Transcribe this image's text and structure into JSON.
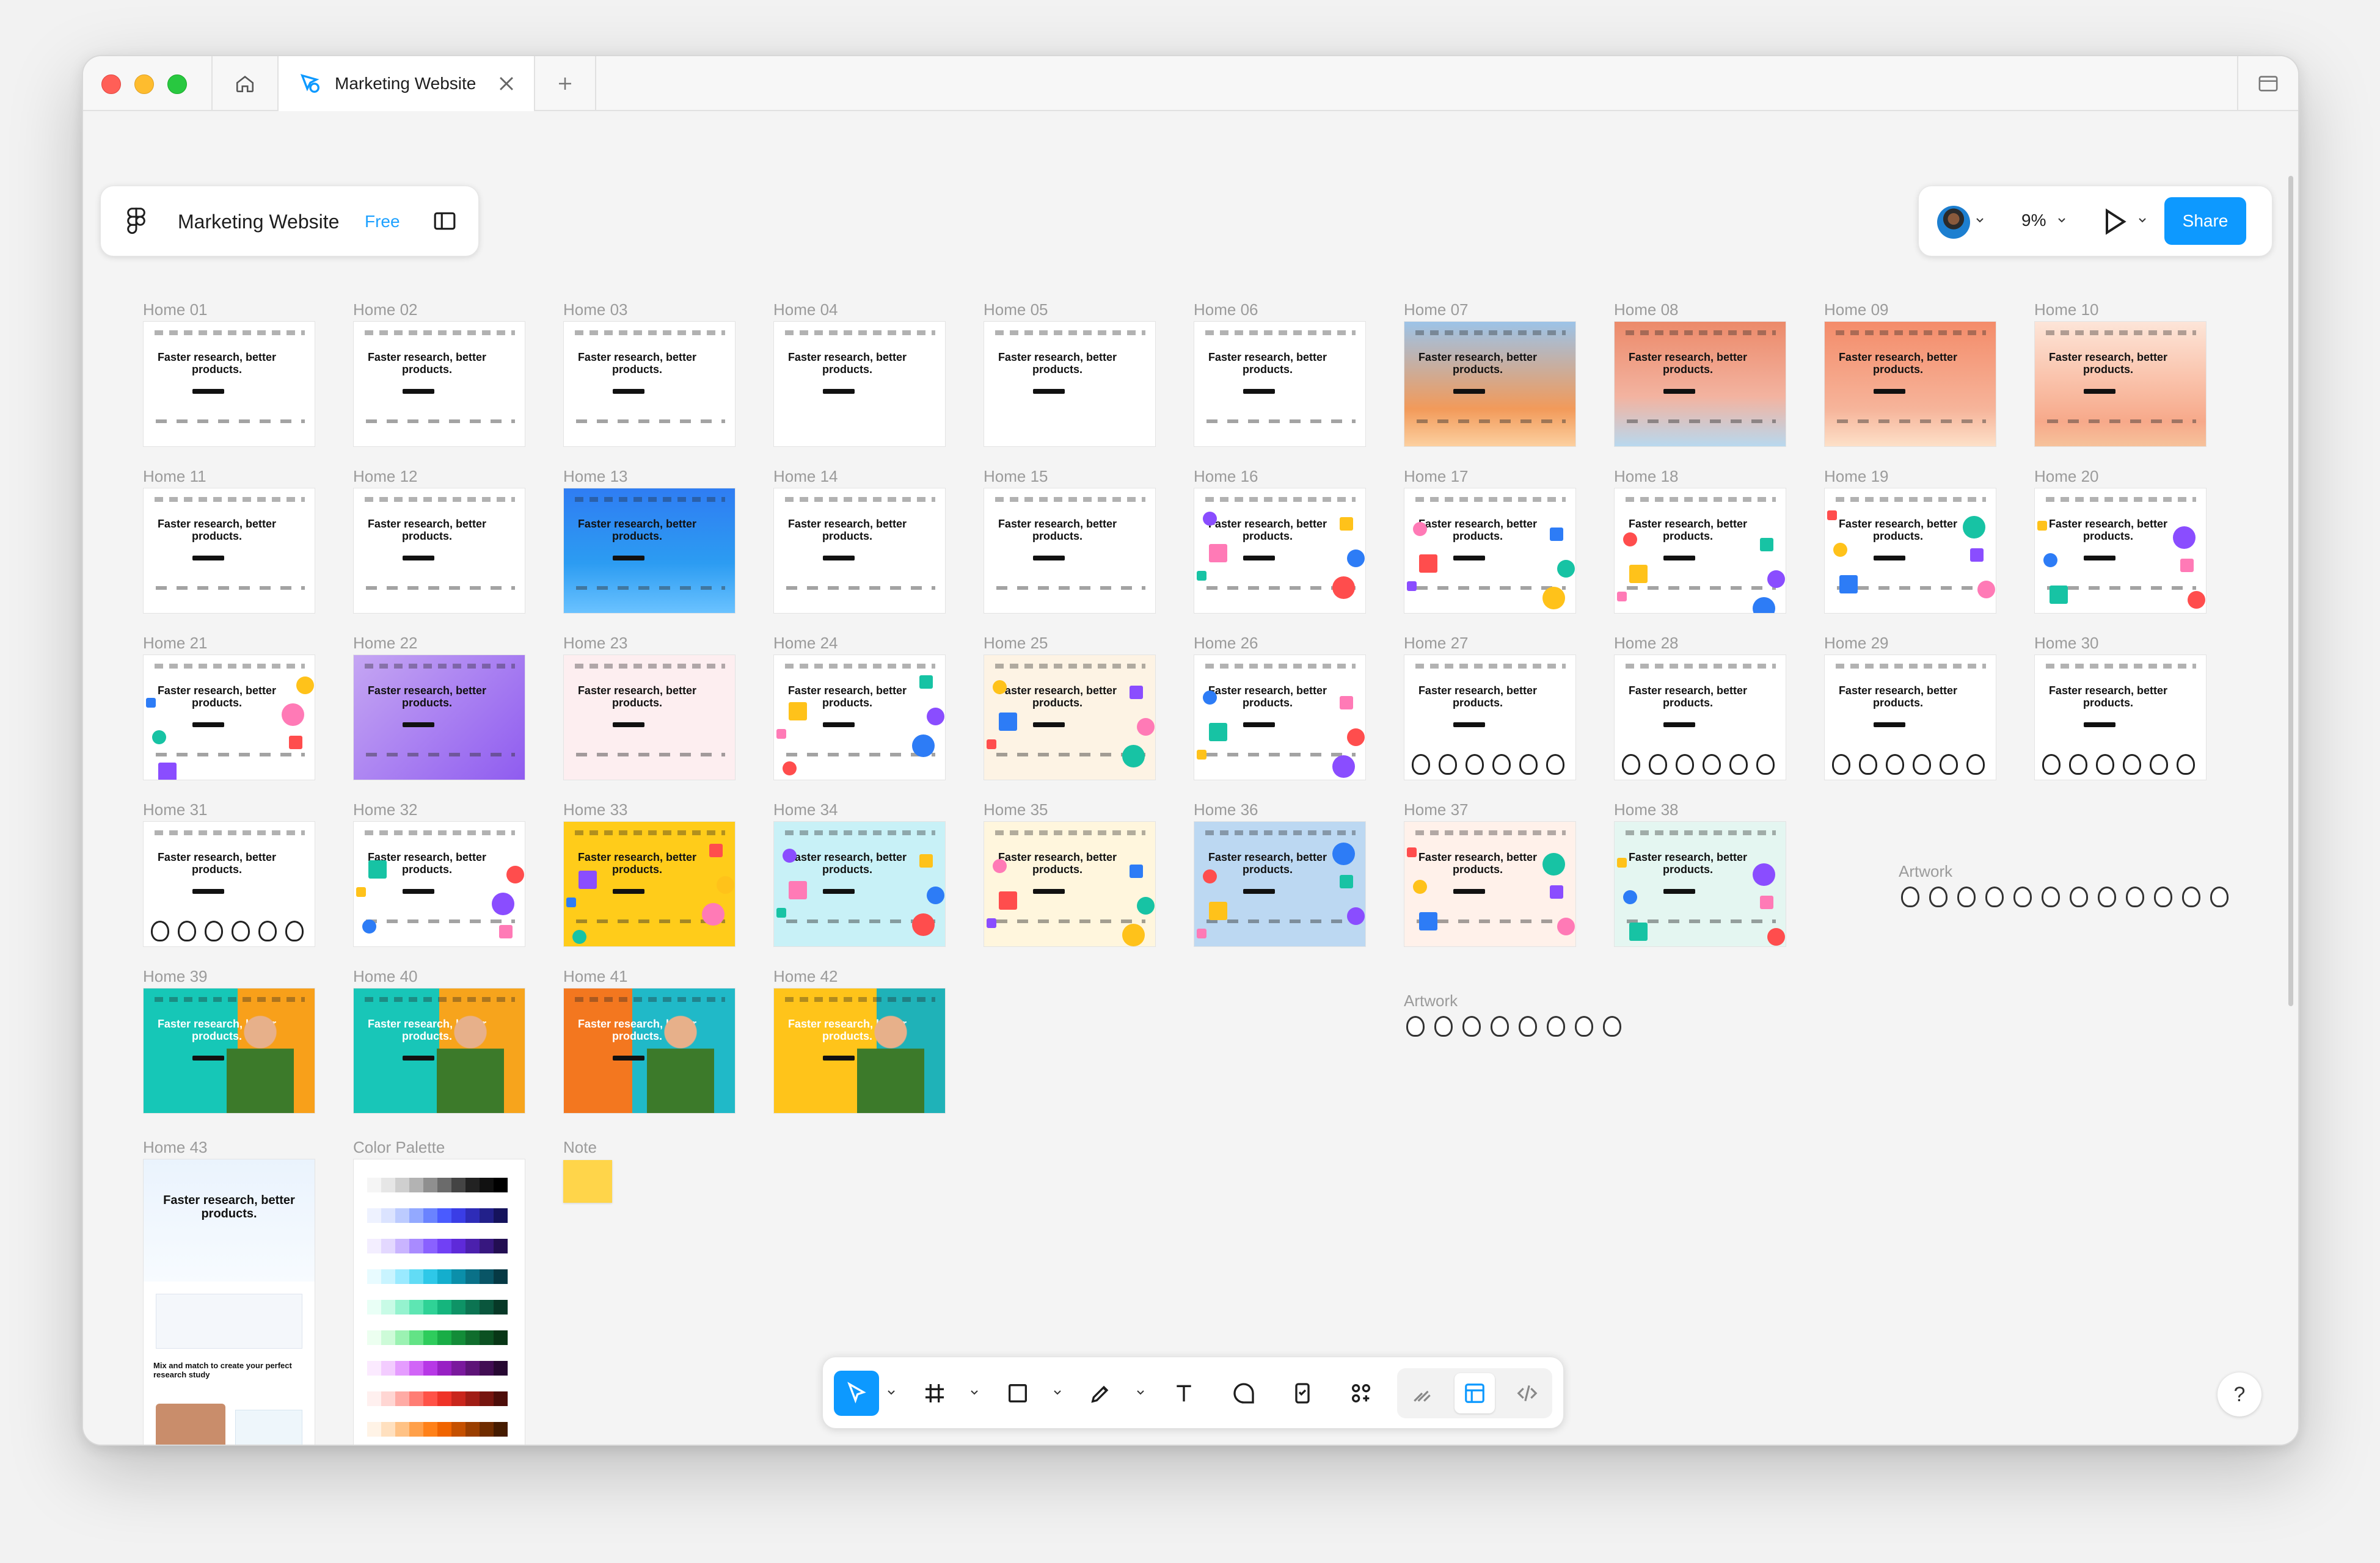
{
  "tabbar": {
    "tab_title": "Marketing Website"
  },
  "file": {
    "name": "Marketing Website",
    "plan": "Free"
  },
  "header": {
    "zoom": "9%",
    "share_label": "Share"
  },
  "thumb_headline": "Faster research, better products.",
  "frames": [
    {
      "label": "Home 01",
      "bg": "#ffffff",
      "style": "plain"
    },
    {
      "label": "Home 02",
      "bg": "#ffffff",
      "style": "plain"
    },
    {
      "label": "Home 03",
      "bg": "#ffffff",
      "style": "plain"
    },
    {
      "label": "Home 04",
      "bg": "#ffffff",
      "style": "green-blob"
    },
    {
      "label": "Home 05",
      "bg": "#ffffff",
      "style": "peach-blob"
    },
    {
      "label": "Home 06",
      "bg": "#ffffff",
      "style": "plain"
    },
    {
      "label": "Home 07",
      "bg": "linear-gradient(180deg,#9cc3e8,#f29a5a 70%,#fcd0a0)",
      "style": "gradient"
    },
    {
      "label": "Home 08",
      "bg": "linear-gradient(180deg,#ec8a6a,#f3b3a0 60%,#b8d8ee)",
      "style": "gradient"
    },
    {
      "label": "Home 09",
      "bg": "linear-gradient(180deg,#f48c6a,#f6b49a 70%,#fde0c8)",
      "style": "gradient"
    },
    {
      "label": "Home 10",
      "bg": "linear-gradient(180deg,#fde5d8,#f7a98a 80%,#f6c29b)",
      "style": "gradient"
    },
    {
      "label": "Home 11",
      "bg": "#ffffff",
      "style": "plain"
    },
    {
      "label": "Home 12",
      "bg": "#ffffff",
      "style": "plain"
    },
    {
      "label": "Home 13",
      "bg": "linear-gradient(180deg,#2f7df3,#2c9cf2 60%,#6ac2ff)",
      "style": "gradient"
    },
    {
      "label": "Home 14",
      "bg": "#ffffff",
      "style": "plain"
    },
    {
      "label": "Home 15",
      "bg": "#ffffff",
      "style": "plain"
    },
    {
      "label": "Home 16",
      "bg": "#ffffff",
      "style": "shapes"
    },
    {
      "label": "Home 17",
      "bg": "#ffffff",
      "style": "shapes"
    },
    {
      "label": "Home 18",
      "bg": "#ffffff",
      "style": "shapes"
    },
    {
      "label": "Home 19",
      "bg": "#ffffff",
      "style": "shapes"
    },
    {
      "label": "Home 20",
      "bg": "#ffffff",
      "style": "shapes"
    },
    {
      "label": "Home 21",
      "bg": "#ffffff",
      "style": "shapes"
    },
    {
      "label": "Home 22",
      "bg": "linear-gradient(135deg,#c5a6f3,#8f5cf0)",
      "style": "gradient"
    },
    {
      "label": "Home 23",
      "bg": "#fdeef0",
      "style": "plain"
    },
    {
      "label": "Home 24",
      "bg": "#ffffff",
      "style": "shapes"
    },
    {
      "label": "Home 25",
      "bg": "#fdf3e4",
      "style": "shapes"
    },
    {
      "label": "Home 26",
      "bg": "#ffffff",
      "style": "shapes"
    },
    {
      "label": "Home 27",
      "bg": "#ffffff",
      "style": "faces"
    },
    {
      "label": "Home 28",
      "bg": "#ffffff",
      "style": "faces"
    },
    {
      "label": "Home 29",
      "bg": "#ffffff",
      "style": "faces"
    },
    {
      "label": "Home 30",
      "bg": "#ffffff",
      "style": "faces"
    },
    {
      "label": "Home 31",
      "bg": "#ffffff",
      "style": "faces"
    },
    {
      "label": "Home 32",
      "bg": "#ffffff",
      "style": "shapes"
    },
    {
      "label": "Home 33",
      "bg": "#ffcc1a",
      "style": "shapes"
    },
    {
      "label": "Home 34",
      "bg": "#c8f1f7",
      "style": "shapes"
    },
    {
      "label": "Home 35",
      "bg": "#fff6dd",
      "style": "shapes"
    },
    {
      "label": "Home 36",
      "bg": "#bcd8f2",
      "style": "shapes"
    },
    {
      "label": "Home 37",
      "bg": "#fff1ea",
      "style": "shapes"
    },
    {
      "label": "Home 38",
      "bg": "#e4f6f1",
      "style": "shapes"
    },
    {
      "label": "Home 39",
      "bg": "linear-gradient(90deg,#16c7b7 55%,#f8a01a 55%)",
      "style": "photo"
    },
    {
      "label": "Home 40",
      "bg": "linear-gradient(90deg,#18c6b8 50%,#f7a41c 50%)",
      "style": "photo"
    },
    {
      "label": "Home 41",
      "bg": "linear-gradient(90deg,#f3771f 40%,#20b9c8 40%)",
      "style": "photo"
    },
    {
      "label": "Home 42",
      "bg": "linear-gradient(90deg,#ffc41a 60%,#1fb2b8 60%)",
      "style": "photo"
    }
  ],
  "home43": {
    "label": "Home 43",
    "headline": "Faster research, better products.",
    "sub": "Mix and match to create your perfect research study"
  },
  "palette": {
    "label": "Color Palette"
  },
  "note": {
    "label": "Note"
  },
  "artwork_a": {
    "label": "Artwork"
  },
  "artwork_b": {
    "label": "Artwork"
  },
  "help": {
    "label": "?"
  },
  "colors": {
    "accent": "#0d99ff",
    "plan_badge": "#1ea1ff"
  }
}
